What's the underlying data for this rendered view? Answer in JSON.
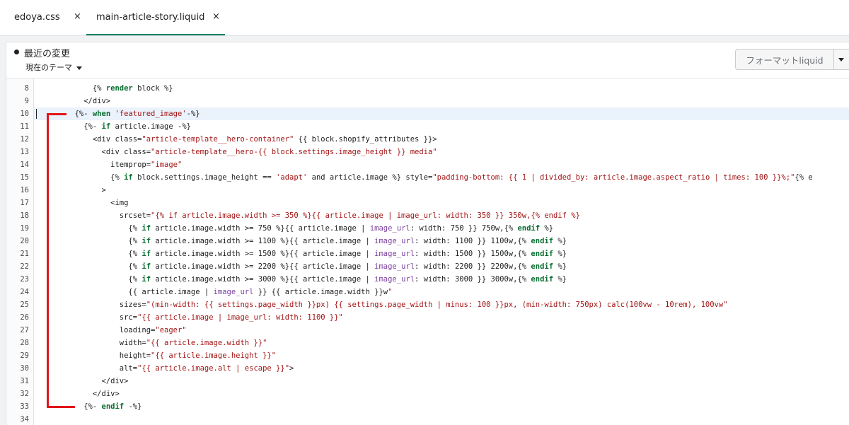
{
  "tabs": [
    {
      "label": "edoya.css",
      "close": "×"
    },
    {
      "label": "main-article-story.liquid",
      "close": "×"
    }
  ],
  "header": {
    "recent_changes": "最近の変更",
    "current_theme": "現在のテーマ",
    "format_button": "フォーマットliquid"
  },
  "colors": {
    "accent": "#008060",
    "highlight_bracket": "#e3141b",
    "keyword": "#0b6e31",
    "string": "#a31515",
    "filter": "#7a3e9d"
  },
  "editor": {
    "active_line": 10,
    "lines": [
      {
        "n": "8",
        "t": "            {% render block %}"
      },
      {
        "n": "9",
        "t": "          </div>"
      },
      {
        "n": "10",
        "t": "        {%- when 'featured_image'-%}"
      },
      {
        "n": "11",
        "t": "          {%- if article.image -%}"
      },
      {
        "n": "12",
        "t": "            <div class=\"article-template__hero-container\" {{ block.shopify_attributes }}>"
      },
      {
        "n": "13",
        "t": "              <div class=\"article-template__hero-{{ block.settings.image_height }} media\""
      },
      {
        "n": "14",
        "t": "                itemprop=\"image\""
      },
      {
        "n": "15",
        "t": "                {% if block.settings.image_height == 'adapt' and article.image %} style=\"padding-bottom: {{ 1 | divided_by: article.image.aspect_ratio | times: 100 }}%;\"{% e"
      },
      {
        "n": "16",
        "t": "              >"
      },
      {
        "n": "17",
        "t": "                <img"
      },
      {
        "n": "18",
        "t": "                  srcset=\"{% if article.image.width >= 350 %}{{ article.image | image_url: width: 350 }} 350w,{% endif %}"
      },
      {
        "n": "19",
        "t": "                    {% if article.image.width >= 750 %}{{ article.image | image_url: width: 750 }} 750w,{% endif %}"
      },
      {
        "n": "20",
        "t": "                    {% if article.image.width >= 1100 %}{{ article.image | image_url: width: 1100 }} 1100w,{% endif %}"
      },
      {
        "n": "21",
        "t": "                    {% if article.image.width >= 1500 %}{{ article.image | image_url: width: 1500 }} 1500w,{% endif %}"
      },
      {
        "n": "22",
        "t": "                    {% if article.image.width >= 2200 %}{{ article.image | image_url: width: 2200 }} 2200w,{% endif %}"
      },
      {
        "n": "23",
        "t": "                    {% if article.image.width >= 3000 %}{{ article.image | image_url: width: 3000 }} 3000w,{% endif %}"
      },
      {
        "n": "24",
        "t": "                    {{ article.image | image_url }} {{ article.image.width }}w\""
      },
      {
        "n": "25",
        "t": "                  sizes=\"(min-width: {{ settings.page_width }}px) {{ settings.page_width | minus: 100 }}px, (min-width: 750px) calc(100vw - 10rem), 100vw\""
      },
      {
        "n": "26",
        "t": "                  src=\"{{ article.image | image_url: width: 1100 }}\""
      },
      {
        "n": "27",
        "t": "                  loading=\"eager\""
      },
      {
        "n": "28",
        "t": "                  width=\"{{ article.image.width }}\""
      },
      {
        "n": "29",
        "t": "                  height=\"{{ article.image.height }}\""
      },
      {
        "n": "30",
        "t": "                  alt=\"{{ article.image.alt | escape }}\">"
      },
      {
        "n": "31",
        "t": "              </div>"
      },
      {
        "n": "32",
        "t": "            </div>"
      },
      {
        "n": "33",
        "t": "          {%- endif -%}"
      },
      {
        "n": "34",
        "t": ""
      }
    ]
  }
}
